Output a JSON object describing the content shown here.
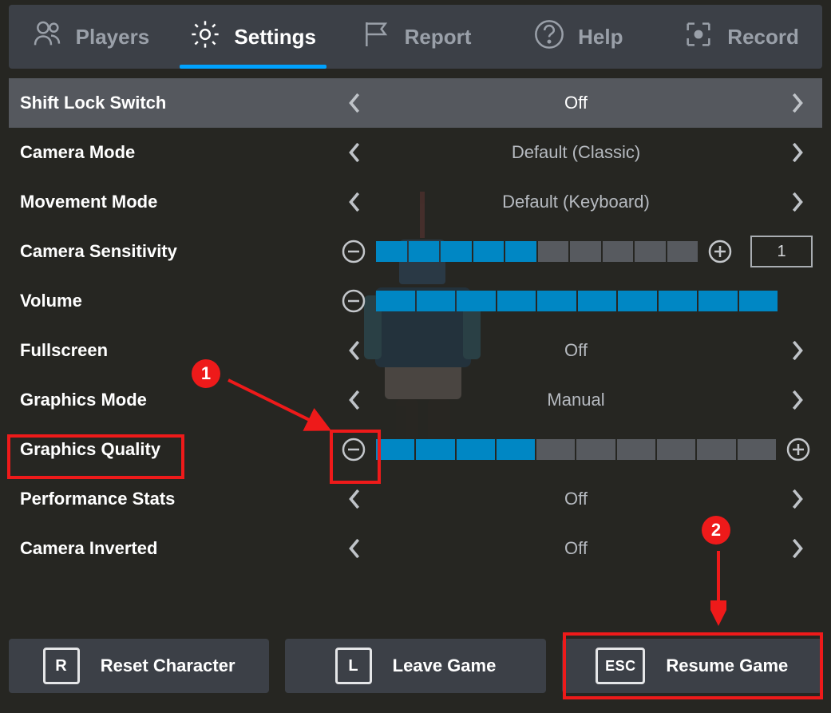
{
  "tabs": [
    {
      "id": "players",
      "label": "Players",
      "icon": "people-icon",
      "active": false
    },
    {
      "id": "settings",
      "label": "Settings",
      "icon": "gear-icon",
      "active": true
    },
    {
      "id": "report",
      "label": "Report",
      "icon": "flag-icon",
      "active": false
    },
    {
      "id": "help",
      "label": "Help",
      "icon": "question-icon",
      "active": false
    },
    {
      "id": "record",
      "label": "Record",
      "icon": "record-icon",
      "active": false
    }
  ],
  "settings": {
    "shiftLock": {
      "label": "Shift Lock Switch",
      "value": "Off",
      "type": "selector",
      "highlight": true
    },
    "cameraMode": {
      "label": "Camera Mode",
      "value": "Default (Classic)",
      "type": "selector"
    },
    "movementMode": {
      "label": "Movement Mode",
      "value": "Default (Keyboard)",
      "type": "selector"
    },
    "cameraSensitivity": {
      "label": "Camera Sensitivity",
      "filled": 5,
      "total": 10,
      "input": "1",
      "type": "slider-input"
    },
    "volume": {
      "label": "Volume",
      "filled": 10,
      "total": 10,
      "type": "slider"
    },
    "fullscreen": {
      "label": "Fullscreen",
      "value": "Off",
      "type": "selector"
    },
    "graphicsMode": {
      "label": "Graphics Mode",
      "value": "Manual",
      "type": "selector"
    },
    "graphicsQuality": {
      "label": "Graphics Quality",
      "filled": 4,
      "total": 10,
      "type": "slider"
    },
    "performanceStats": {
      "label": "Performance Stats",
      "value": "Off",
      "type": "selector"
    },
    "cameraInverted": {
      "label": "Camera Inverted",
      "value": "Off",
      "type": "selector"
    }
  },
  "footer": {
    "reset": {
      "key": "R",
      "label": "Reset Character"
    },
    "leave": {
      "key": "L",
      "label": "Leave Game"
    },
    "resume": {
      "key": "ESC",
      "label": "Resume Game"
    }
  },
  "annotations": {
    "marker1": "1",
    "marker2": "2"
  }
}
